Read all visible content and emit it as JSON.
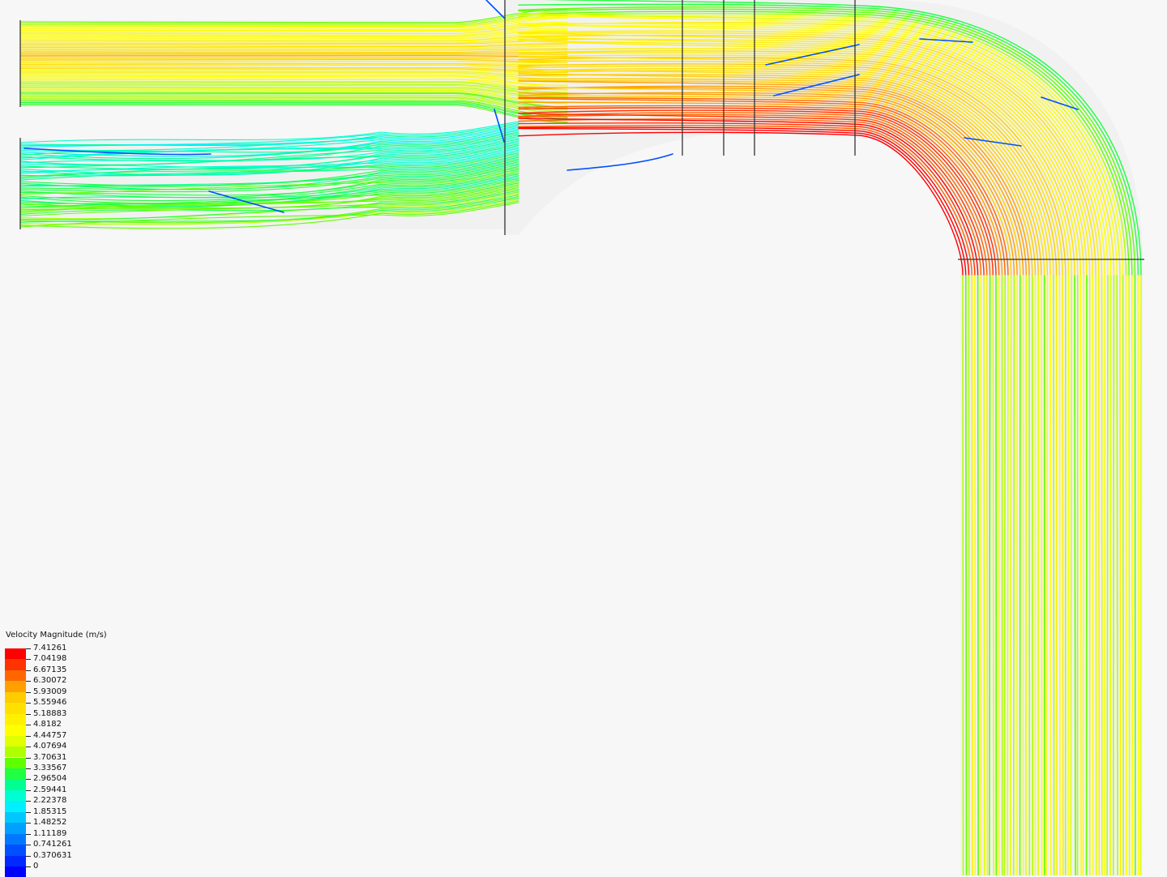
{
  "view": {
    "background": "#f7f7f7",
    "pipe_surface_color": "#ececec",
    "visualization": "velocity-streamlines"
  },
  "legend": {
    "title": "Velocity Magnitude (m/s)",
    "colors": [
      "#ff0000",
      "#ff3300",
      "#ff6600",
      "#ffa000",
      "#ffcc00",
      "#ffe000",
      "#fff000",
      "#ffff00",
      "#e0ff00",
      "#b0ff00",
      "#60ff00",
      "#20ff40",
      "#00ff90",
      "#00ffd0",
      "#00f0ff",
      "#00c8ff",
      "#00a0ff",
      "#0078ff",
      "#0050ff",
      "#0028ff",
      "#0000ff"
    ],
    "labels": [
      "7.41261",
      "7.04198",
      "6.67135",
      "6.30072",
      "5.93009",
      "5.55946",
      "5.18883",
      "4.8182",
      "4.44757",
      "4.07694",
      "3.70631",
      "3.33567",
      "2.96504",
      "2.59441",
      "2.22378",
      "1.85315",
      "1.48252",
      "1.11189",
      "0.741261",
      "0.370631",
      "0"
    ]
  }
}
